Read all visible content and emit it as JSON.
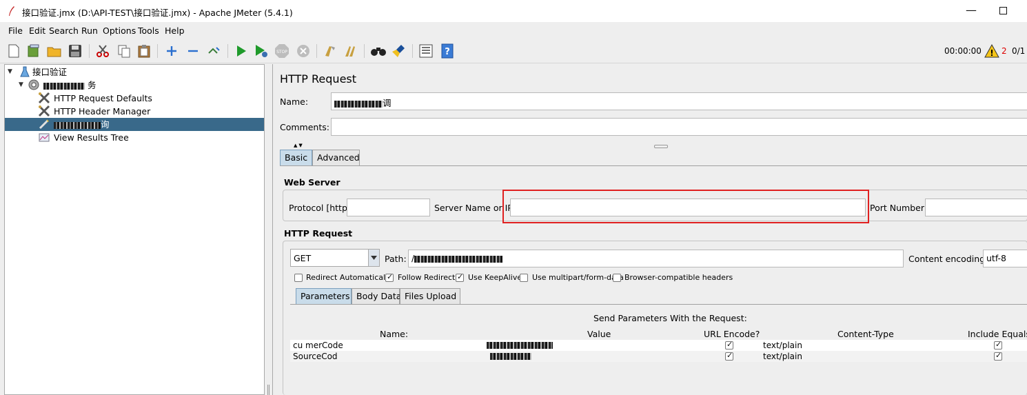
{
  "window": {
    "title": "接口验证.jmx (D:\\API-TEST\\接口验证.jmx) - Apache JMeter (5.4.1)",
    "minimize": "—"
  },
  "menu": [
    "File",
    "Edit",
    "Search",
    "Run",
    "Options",
    "Tools",
    "Help"
  ],
  "toolbar": {
    "timer": "00:00:00",
    "warnings": "2",
    "threads": "0/1",
    "icons": [
      "new-icon",
      "templates-icon",
      "open-icon",
      "save-icon",
      "cut-icon",
      "copy-icon",
      "paste-icon",
      "expand-icon",
      "collapse-icon",
      "toggle-icon",
      "start-icon",
      "start-no-pause-icon",
      "stop-icon",
      "shutdown-icon",
      "clear-icon",
      "clear-all-icon",
      "search-icon",
      "reset-search-icon",
      "function-helper-icon",
      "help-icon"
    ]
  },
  "tree": {
    "items": [
      {
        "label": "接口验证",
        "icon": "test-plan-icon"
      },
      {
        "label": "务",
        "icon": "thread-group-icon"
      },
      {
        "label": "HTTP Request Defaults",
        "icon": "config-element-icon"
      },
      {
        "label": "HTTP Header Manager",
        "icon": "config-element-icon"
      },
      {
        "label": "询",
        "icon": "sampler-icon"
      },
      {
        "label": "View Results Tree",
        "icon": "listener-icon"
      }
    ]
  },
  "panel": {
    "title": "HTTP Request",
    "name_label": "Name:",
    "name_value": "调",
    "comments_label": "Comments:",
    "comments_value": "",
    "tabs": [
      "Basic",
      "Advanced"
    ],
    "web_server": {
      "title": "Web Server",
      "protocol_label": "Protocol [http]:",
      "protocol_value": "",
      "server_label": "Server Name or IP:",
      "server_value": "",
      "port_label": "Port Number:",
      "port_value": ""
    },
    "http_request": {
      "title": "HTTP Request",
      "method": "GET",
      "path_label": "Path:",
      "path_value": "/",
      "encoding_label": "Content encoding:",
      "encoding_value": "utf-8",
      "checkboxes": [
        {
          "label": "Redirect Automatically",
          "checked": false
        },
        {
          "label": "Follow Redirects",
          "checked": true
        },
        {
          "label": "Use KeepAlive",
          "checked": true
        },
        {
          "label": "Use multipart/form-data",
          "checked": false
        },
        {
          "label": "Browser-compatible headers",
          "checked": false
        }
      ],
      "subtabs": [
        "Parameters",
        "Body Data",
        "Files Upload"
      ]
    },
    "params": {
      "caption": "Send Parameters With the Request:",
      "columns": [
        "Name:",
        "Value",
        "URL Encode?",
        "Content-Type",
        "Include Equals?"
      ],
      "rows": [
        {
          "name": "cu   merCode",
          "content_type": "text/plain",
          "url_encode": true,
          "include_equals": true
        },
        {
          "name": "SourceCod",
          "content_type": "text/plain",
          "url_encode": true,
          "include_equals": true
        }
      ]
    }
  }
}
